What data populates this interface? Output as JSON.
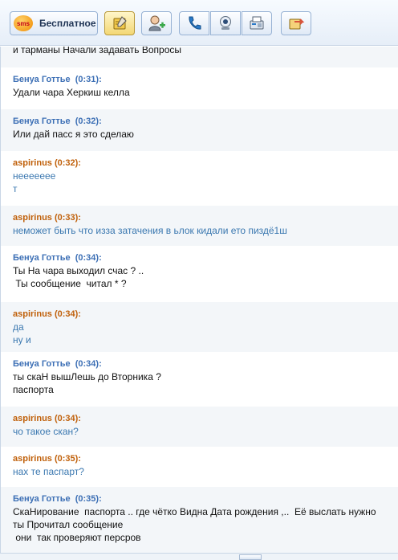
{
  "toolbar": {
    "sms_badge": "sms",
    "sms_label": "Бесплатное",
    "icons": [
      "notes-icon",
      "add-contact-icon",
      "phone-icon",
      "webcam-icon",
      "fax-icon",
      "send-file-icon"
    ]
  },
  "messages": [
    {
      "author": "",
      "time": "",
      "lines": [
        "и тарманы Начали задавать Вопросы"
      ]
    },
    {
      "author": "Бенуа Готтье",
      "time": "(0:31):",
      "lines": [
        "Удали чара Херкиш келла"
      ]
    },
    {
      "author": "Бенуа Готтье",
      "time": "(0:32):",
      "lines": [
        "Или дай пасс я это сделаю"
      ]
    },
    {
      "author": "aspirinus",
      "time": "(0:32):",
      "lines": [
        "неееееее",
        "т"
      ]
    },
    {
      "author": "aspirinus",
      "time": "(0:33):",
      "lines": [
        "неможет быть что изза затачения в ьлок кидали ето пиздё1ш"
      ]
    },
    {
      "author": "Бенуа Готтье",
      "time": "(0:34):",
      "lines": [
        "Ты На чара выходил счас ? ..",
        " Ты сообщение  читал * ?"
      ]
    },
    {
      "author": "aspirinus",
      "time": "(0:34):",
      "lines": [
        "да",
        "ну и"
      ]
    },
    {
      "author": "Бенуа Готтье",
      "time": "(0:34):",
      "lines": [
        "ты скаН вышЛешь до Вторника ?",
        "паспорта"
      ]
    },
    {
      "author": "aspirinus",
      "time": "(0:34):",
      "lines": [
        "чо такое скан?"
      ]
    },
    {
      "author": "aspirinus",
      "time": "(0:35):",
      "lines": [
        "нах те паспарт?"
      ]
    },
    {
      "author": "Бенуа Готтье",
      "time": "(0:35):",
      "lines": [
        "СкаНирование  паспорта .. где чётко Видна Дата рождения ,..  Её выслать нужно",
        "ты Прочитал сообщение",
        " они  так проверяют персров"
      ]
    }
  ],
  "colors": {
    "author_blue": "#3c6fb5",
    "author_orange": "#c0600a",
    "text_orange_msg": "#3b78b0"
  }
}
